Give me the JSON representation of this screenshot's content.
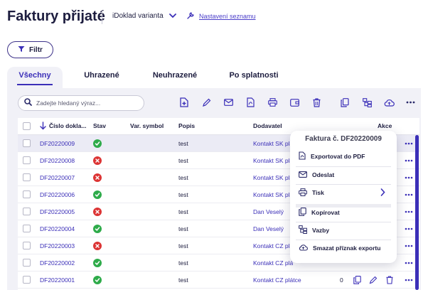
{
  "header": {
    "title": "Faktury přijaté",
    "variant_label": "iDoklad varianta",
    "settings_link": "Nastavení seznamu"
  },
  "filter": {
    "label": "Filtr"
  },
  "tabs": [
    {
      "label": "Všechny",
      "active": true
    },
    {
      "label": "Uhrazené",
      "active": false
    },
    {
      "label": "Neuhrazené",
      "active": false
    },
    {
      "label": "Po splatnosti",
      "active": false
    }
  ],
  "search": {
    "placeholder": "Zadejte hledaný výraz..."
  },
  "toolbar": {
    "icons": [
      "add-document-icon",
      "edit-icon",
      "email-icon",
      "pdf-icon",
      "print-icon",
      "wallet-icon",
      "trash-icon",
      "copy-icon",
      "relations-icon",
      "cloud-icon",
      "more-icon"
    ]
  },
  "table": {
    "columns": {
      "number": "Číslo dokla...",
      "status": "Stav",
      "var_symbol": "Var. symbol",
      "description": "Popis",
      "supplier": "Dodavatel",
      "actions": "Akce"
    },
    "rows": [
      {
        "number": "DF20220009",
        "status": "ok",
        "description": "test",
        "supplier": "Kontakt SK plá"
      },
      {
        "number": "DF20220008",
        "status": "bad",
        "description": "test",
        "supplier": "Kontakt SK plá"
      },
      {
        "number": "DF20220007",
        "status": "bad",
        "description": "test",
        "supplier": "Kontakt SK plá"
      },
      {
        "number": "DF20220006",
        "status": "ok",
        "description": "test",
        "supplier": "Kontakt SK plá"
      },
      {
        "number": "DF20220005",
        "status": "bad",
        "description": "test",
        "supplier": "Dan Veselý"
      },
      {
        "number": "DF20220004",
        "status": "ok",
        "description": "test",
        "supplier": "Dan Veselý"
      },
      {
        "number": "DF20220003",
        "status": "bad",
        "description": "test",
        "supplier": "Kontakt CZ plá"
      },
      {
        "number": "DF20220002",
        "status": "ok",
        "description": "test",
        "supplier": "Kontakt CZ plá"
      },
      {
        "number": "DF20220001",
        "status": "ok",
        "description": "test",
        "supplier": "Kontakt CZ plátce"
      }
    ],
    "last_row_extra": "0"
  },
  "context_menu": {
    "title": "Faktura č. DF20220009",
    "items": [
      {
        "label": "Exportovat do PDF",
        "icon": "pdf-icon"
      },
      {
        "label": "Odeslat",
        "icon": "email-icon"
      },
      {
        "label": "Tisk",
        "icon": "print-icon"
      },
      {
        "label": "Kopírovat",
        "icon": "copy-icon"
      },
      {
        "label": "Vazby",
        "icon": "relations-icon"
      },
      {
        "label": "Smazat příznak exportu",
        "icon": "cloud-icon"
      }
    ]
  },
  "colors": {
    "accent": "#3b2fb8",
    "panel": "#f1f1f7",
    "ok": "#2eab4a",
    "error": "#dc3434"
  }
}
